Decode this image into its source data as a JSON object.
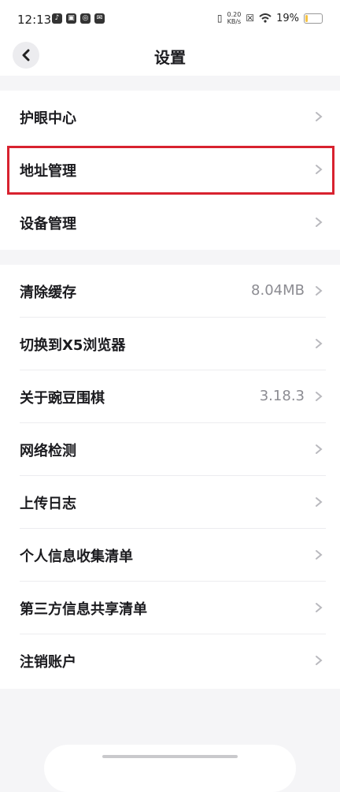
{
  "status_bar": {
    "time": "12:13",
    "net_speed_value": "0.20",
    "net_speed_unit": "KB/s",
    "battery": "19%",
    "battery_fraction": 0.19
  },
  "header": {
    "title": "设置"
  },
  "group1": [
    {
      "label": "护眼中心"
    },
    {
      "label": "地址管理"
    },
    {
      "label": "设备管理"
    }
  ],
  "group2": [
    {
      "label": "清除缓存",
      "value": "8.04MB"
    },
    {
      "label": "切换到X5浏览器"
    },
    {
      "label": "关于豌豆围棋",
      "value": "3.18.3"
    },
    {
      "label": "网络检测"
    },
    {
      "label": "上传日志"
    },
    {
      "label": "个人信息收集清单"
    },
    {
      "label": "第三方信息共享清单"
    },
    {
      "label": "注销账户"
    }
  ],
  "colors": {
    "highlight": "#d8222f",
    "value_text": "#8c8c92",
    "accent_battery": "#f6c344"
  }
}
